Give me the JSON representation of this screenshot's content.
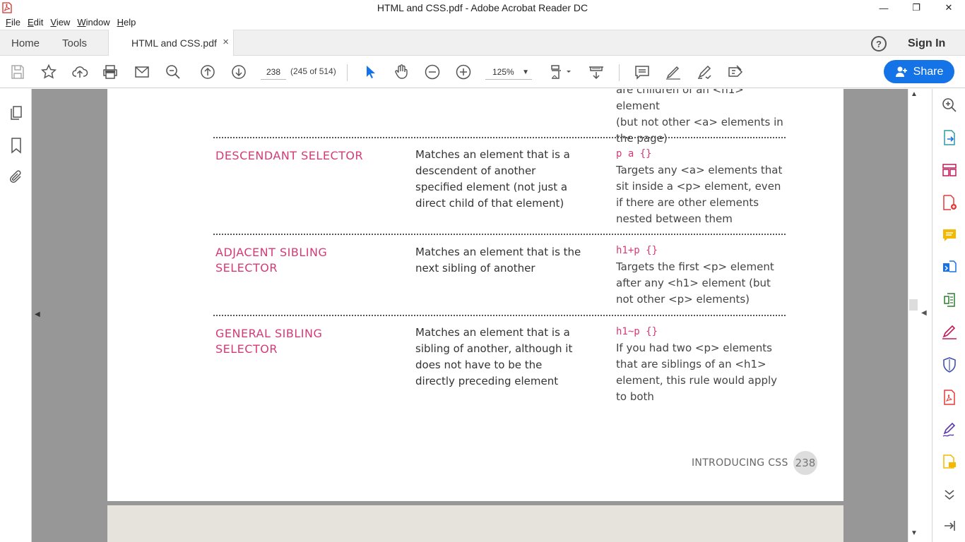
{
  "window": {
    "title": "HTML and CSS.pdf - Adobe Acrobat Reader DC",
    "minimize": "—",
    "maximize": "❐",
    "close": "✕"
  },
  "menu": {
    "items": [
      {
        "u": "F",
        "rest": "ile"
      },
      {
        "u": "E",
        "rest": "dit"
      },
      {
        "u": "V",
        "rest": "iew"
      },
      {
        "u": "W",
        "rest": "indow"
      },
      {
        "u": "H",
        "rest": "elp"
      }
    ]
  },
  "tabs": {
    "home": "Home",
    "tools": "Tools",
    "document": "HTML and CSS.pdf",
    "close": "×",
    "help": "?",
    "sign_in": "Sign In"
  },
  "toolbar": {
    "page_number": "238",
    "page_count": "(245 of 514)",
    "zoom": "125%",
    "zoom_chevron": "▼",
    "share_label": "Share"
  },
  "document": {
    "top_fragment": [
      "are children of an <h1> element",
      "(but not other <a> elements in",
      "the page)"
    ],
    "rows": [
      {
        "name": [
          "DESCENDANT SELECTOR"
        ],
        "description": "Matches an element that is a descendent of another specified element (not just a direct child of that element)",
        "code": "p a {}",
        "example": "Targets any <a> elements that sit inside a <p> element, even if there are other elements nested between them"
      },
      {
        "name": [
          "ADJACENT SIBLING",
          "SELECTOR"
        ],
        "description": "Matches an element that is the next sibling of another",
        "code": "h1+p {}",
        "example": "Targets the first <p> element after any <h1> element (but not other <p> elements)"
      },
      {
        "name": [
          "GENERAL SIBLING",
          "SELECTOR"
        ],
        "description": "Matches an element that is a sibling of another, although it does not have to be the directly preceding element",
        "code": "h1~p {}",
        "example": "If you had two <p> elements that are siblings of an <h1> element, this rule would apply to both"
      }
    ],
    "footer_label": "INTRODUCING CSS",
    "footer_page": "238"
  },
  "colors": {
    "accent": "#d63a76",
    "share_button": "#1473e6"
  }
}
